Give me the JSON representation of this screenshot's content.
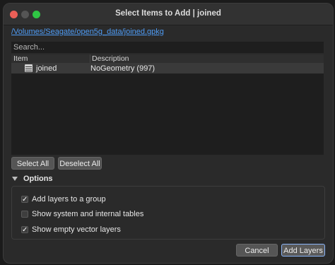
{
  "window": {
    "title": "Select Items to Add | joined"
  },
  "path": "/Volumes/Seagate/open5g_data/joined.gpkg",
  "search": {
    "placeholder": "Search..."
  },
  "tree": {
    "columns": [
      "Item",
      "Description"
    ],
    "rows": [
      {
        "item": "joined",
        "description": "NoGeometry (997)",
        "icon": "table-icon"
      }
    ]
  },
  "selection_buttons": {
    "select_all": "Select All",
    "deselect_all": "Deselect All"
  },
  "options": {
    "header": "Options",
    "items": [
      {
        "label": "Add layers to a group",
        "checked": true
      },
      {
        "label": "Show system and internal tables",
        "checked": false
      },
      {
        "label": "Show empty vector layers",
        "checked": true
      }
    ]
  },
  "footer": {
    "cancel": "Cancel",
    "add_layers": "Add Layers"
  }
}
